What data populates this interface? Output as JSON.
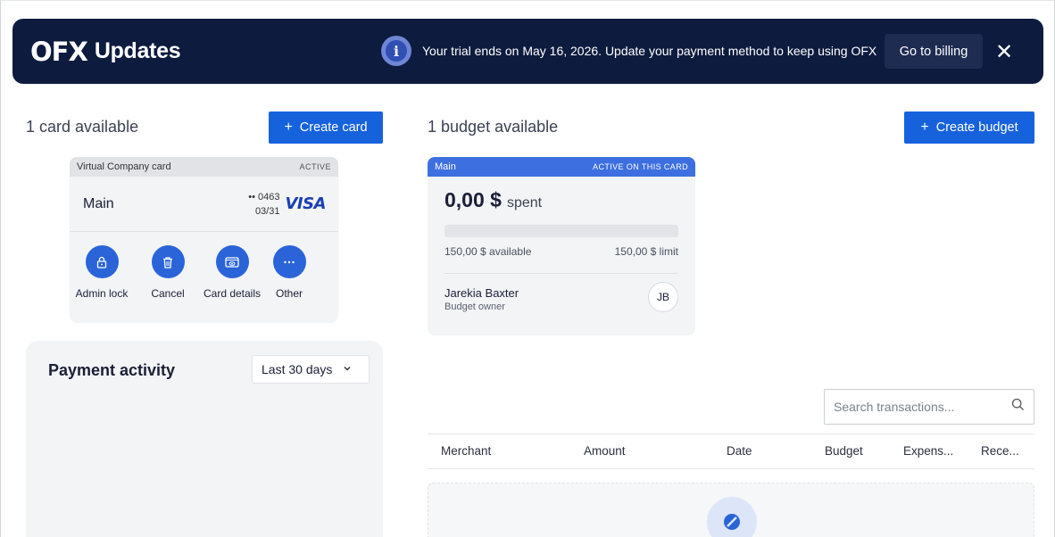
{
  "banner": {
    "logo": "OFX",
    "title": "Updates",
    "message": "Your trial ends on May 16, 2026. Update your payment method to keep using OFX",
    "billing_label": "Go to billing",
    "close_label": "✕"
  },
  "cards": {
    "heading": "1 card available",
    "create_label": "Create card",
    "card": {
      "type_label": "Virtual Company card",
      "status": "ACTIVE",
      "name": "Main",
      "last4": "•• 0463",
      "expiry": "03/31",
      "network": "VISA"
    },
    "actions": [
      {
        "label": "Admin lock",
        "icon": "lock-icon"
      },
      {
        "label": "Cancel",
        "icon": "trash-icon"
      },
      {
        "label": "Card details",
        "icon": "card-eye-icon"
      },
      {
        "label": "Other",
        "icon": "more-icon"
      }
    ]
  },
  "budgets": {
    "heading": "1 budget available",
    "create_label": "Create budget",
    "budget": {
      "name": "Main",
      "status": "ACTIVE ON THIS CARD",
      "spent_amount": "0,00 $",
      "spent_label": "spent",
      "spent_fraction": 0,
      "available": "150,00 $ available",
      "limit": "150,00 $ limit",
      "owner_name": "Jarekia Baxter",
      "owner_role": "Budget owner",
      "owner_initials": "JB"
    }
  },
  "activity": {
    "title": "Payment activity",
    "range": "Last 30 days"
  },
  "transactions": {
    "search_placeholder": "Search transactions...",
    "columns": [
      "Merchant",
      "Amount",
      "Date",
      "Budget",
      "Expens...",
      "Rece..."
    ]
  },
  "colors": {
    "banner_bg": "#0d1b3e",
    "primary": "#1662dd",
    "budget_header": "#3d6fe0"
  }
}
